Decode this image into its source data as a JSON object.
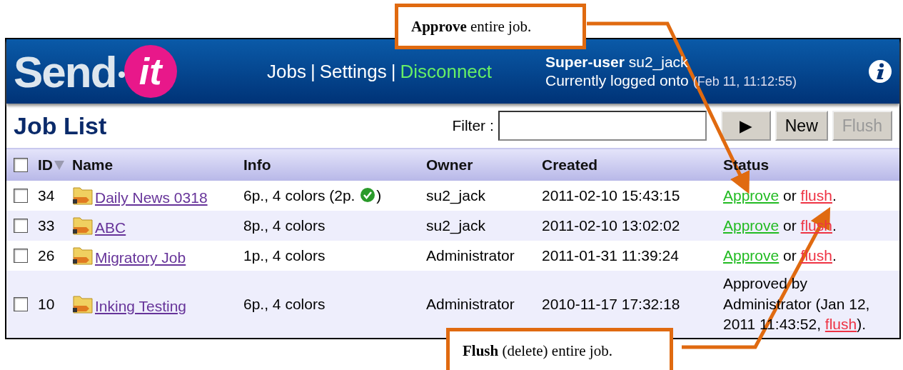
{
  "header": {
    "logo": {
      "word": "Send",
      "badge": "it"
    },
    "nav": [
      {
        "label": "Jobs",
        "color": "#ffffff"
      },
      {
        "label": "Settings",
        "color": "#ffffff"
      },
      {
        "label": "Disconnect",
        "color": "#66ee66"
      }
    ],
    "separator": "|",
    "user": {
      "role": "Super-user",
      "name": "su2_jack",
      "status": "Currently logged onto",
      "time": "(Feb 11, 11:12:55)"
    }
  },
  "toolbar": {
    "title": "Job List",
    "filter_label": "Filter :",
    "buttons": [
      {
        "label": "▶",
        "disabled": false
      },
      {
        "label": "New",
        "disabled": false
      },
      {
        "label": "Flush",
        "disabled": true
      }
    ]
  },
  "table": {
    "select_all_checked": false,
    "columns": [
      "ID",
      "Name",
      "Info",
      "Owner",
      "Created",
      "Status"
    ],
    "rows": [
      {
        "checked": false,
        "id": "34",
        "name": "Daily News 0318",
        "info": "6p., 4 colors",
        "note": {
          "prefix": "(2p.",
          "suffix": ")"
        },
        "owner": "su2_jack",
        "created": "2011-02-10 15:43:15",
        "status": {
          "kind": "pending",
          "approve": "Approve",
          "middle": "or",
          "flush": "flush",
          "end": "."
        }
      },
      {
        "checked": false,
        "id": "33",
        "name": "ABC",
        "info": "8p., 4 colors",
        "owner": "su2_jack",
        "created": "2011-02-10 13:02:02",
        "status": {
          "kind": "pending",
          "approve": "Approve",
          "middle": "or",
          "flush": "flush",
          "end": "."
        }
      },
      {
        "checked": false,
        "id": "26",
        "name": "Migratory Job",
        "info": "1p., 4 colors",
        "owner": "Administrator",
        "created": "2011-01-31 11:39:24",
        "status": {
          "kind": "pending",
          "approve": "Approve",
          "middle": "or",
          "flush": "flush",
          "end": "."
        }
      },
      {
        "checked": false,
        "id": "10",
        "name": "Inking Testing",
        "info": "6p., 4 colors",
        "owner": "Administrator",
        "created": "2010-11-17 17:32:18",
        "status": {
          "kind": "approved",
          "text": "Approved by Administrator (Jan 12, 2011 11:43:52,",
          "flush": "flush",
          "end": ")."
        }
      }
    ]
  },
  "callouts": [
    {
      "text": "**Approve** entire job."
    },
    {
      "text": "**Flush** (delete) entire job."
    }
  ]
}
